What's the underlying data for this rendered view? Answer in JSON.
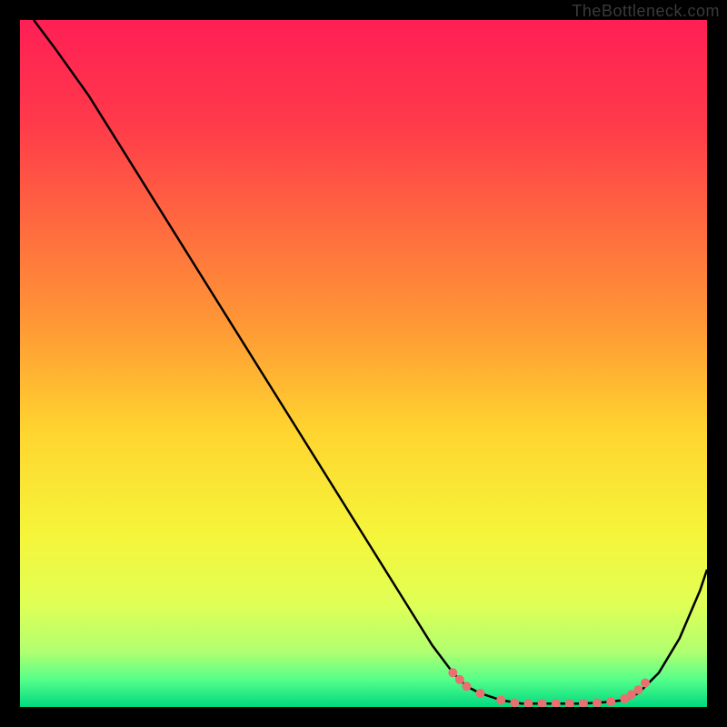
{
  "watermark": "TheBottleneck.com",
  "chart_data": {
    "type": "line",
    "title": "",
    "xlabel": "",
    "ylabel": "",
    "xlim": [
      0,
      100
    ],
    "ylim": [
      0,
      100
    ],
    "series": [
      {
        "name": "curve",
        "color": "#000000",
        "x": [
          2,
          5,
          10,
          15,
          20,
          25,
          30,
          35,
          40,
          45,
          50,
          55,
          60,
          63,
          65,
          67,
          70,
          73,
          76,
          79,
          82,
          85,
          88,
          90,
          93,
          96,
          99,
          100
        ],
        "y": [
          100,
          96,
          89,
          81,
          73,
          65,
          57,
          49,
          41,
          33,
          25,
          17,
          9,
          5,
          3,
          2,
          1,
          0.5,
          0.5,
          0.5,
          0.5,
          0.7,
          1,
          2,
          5,
          10,
          17,
          20
        ]
      }
    ],
    "highlighted_points": {
      "color": "#e87070",
      "points": [
        {
          "x": 63,
          "y": 5
        },
        {
          "x": 64,
          "y": 4
        },
        {
          "x": 65,
          "y": 3
        },
        {
          "x": 67,
          "y": 2
        },
        {
          "x": 70,
          "y": 1
        },
        {
          "x": 72,
          "y": 0.6
        },
        {
          "x": 74,
          "y": 0.5
        },
        {
          "x": 76,
          "y": 0.5
        },
        {
          "x": 78,
          "y": 0.5
        },
        {
          "x": 80,
          "y": 0.5
        },
        {
          "x": 82,
          "y": 0.5
        },
        {
          "x": 84,
          "y": 0.6
        },
        {
          "x": 86,
          "y": 0.8
        },
        {
          "x": 88,
          "y": 1.2
        },
        {
          "x": 89,
          "y": 1.8
        },
        {
          "x": 90,
          "y": 2.5
        },
        {
          "x": 91,
          "y": 3.5
        }
      ]
    },
    "gradient_stops": [
      {
        "offset": 0,
        "color": "#ff1f55"
      },
      {
        "offset": 15,
        "color": "#ff3a4a"
      },
      {
        "offset": 30,
        "color": "#ff6a3f"
      },
      {
        "offset": 45,
        "color": "#ff9a35"
      },
      {
        "offset": 60,
        "color": "#ffd52f"
      },
      {
        "offset": 75,
        "color": "#f5f53a"
      },
      {
        "offset": 85,
        "color": "#e0ff55"
      },
      {
        "offset": 92,
        "color": "#b0ff70"
      },
      {
        "offset": 96,
        "color": "#55ff8a"
      },
      {
        "offset": 100,
        "color": "#00d980"
      }
    ]
  }
}
